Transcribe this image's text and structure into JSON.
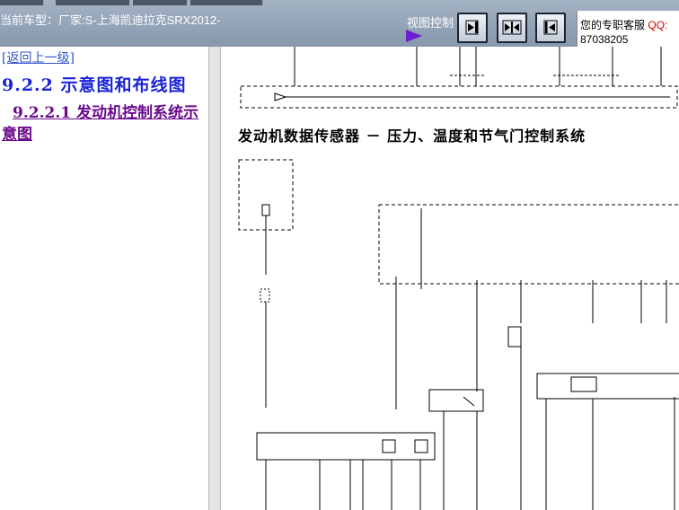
{
  "toolbar": {
    "car_label": "当前车型：厂家:S-上海凯迪拉克SRX2012-",
    "view_control_label": "视图控制",
    "support_label": "您的专职客服",
    "support_qq": "QQ:",
    "support_number": "87038205"
  },
  "left_pane": {
    "back_link": "[返回上一级]",
    "section_title": "9.2.2 示意图和布线图",
    "subsection_link": "9.2.2.1 发动机控制系统示意图"
  },
  "diagram": {
    "title": "发动机数据传感器 － 压力、温度和节气门控制系统"
  }
}
